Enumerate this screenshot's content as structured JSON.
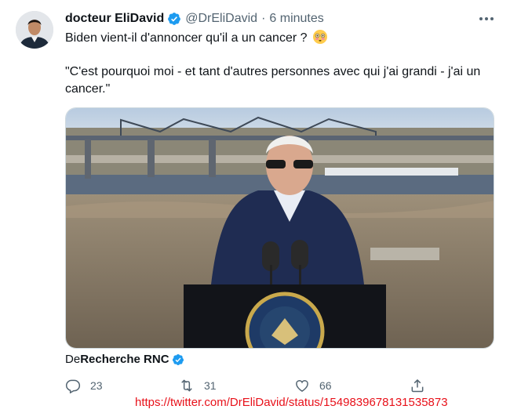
{
  "tweet": {
    "author_name": "docteur EliDavid",
    "handle": "@DrEliDavid",
    "separator": "·",
    "time": "6 minutes",
    "text_line1": "Biden vient-il d'annoncer qu'il a un cancer ?",
    "text_quote": "\"C'est pourquoi moi - et tant d'autres personnes avec qui j'ai grandi - j'ai un cancer.\"",
    "emoji_icon": "flushed-face-emoji",
    "source_prefix": "De",
    "source_name": "Recherche RNC",
    "replies": "23",
    "retweets": "31",
    "likes": "66"
  },
  "watermark_url": "https://twitter.com/DrEliDavid/status/1549839678131535873",
  "colors": {
    "verified": "#1d9bf0",
    "secondary_text": "#536471",
    "url_red": "#e8111a"
  }
}
